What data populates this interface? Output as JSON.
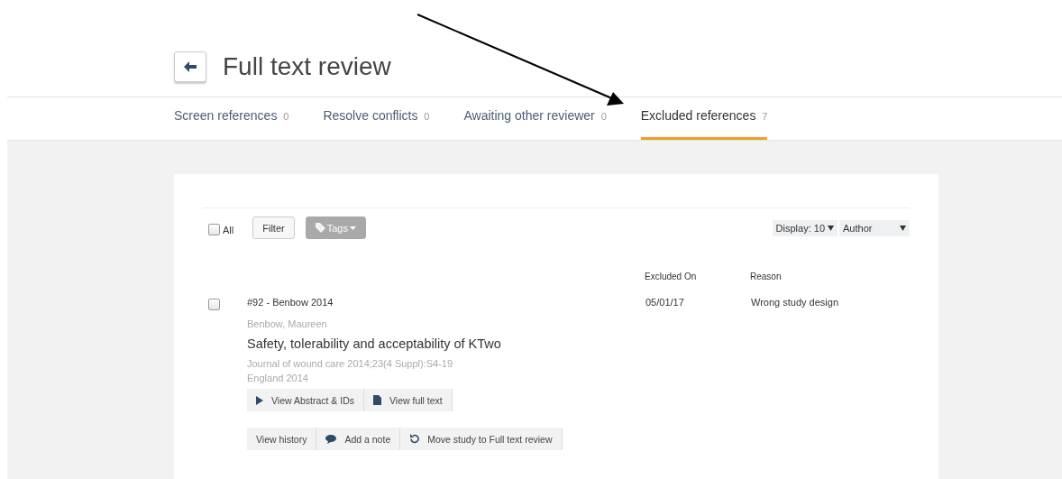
{
  "page": {
    "title": "Full text review"
  },
  "tabs": [
    {
      "label": "Screen references",
      "count": "0",
      "selected": false
    },
    {
      "label": "Resolve conflicts",
      "count": "0",
      "selected": false
    },
    {
      "label": "Awaiting other reviewer",
      "count": "0",
      "selected": false
    },
    {
      "label": "Excluded references",
      "count": "7",
      "selected": true
    }
  ],
  "toolbar": {
    "select_all": {
      "label": "All",
      "checked": false
    },
    "filter": "Filter",
    "tags": {
      "label": "Tags",
      "disabled": true
    },
    "display": "Display: 10",
    "sort": "Author"
  },
  "columns": [
    "Excluded On",
    "Reason"
  ],
  "references": [
    {
      "checked": false,
      "id": "#92 - Benbow 2014",
      "authors": "Benbow, Maureen",
      "title": "Safety, tolerability and acceptability of KTwo",
      "journal": "Journal of wound care 2014;23(4 Suppl):S4-19",
      "country": "England 2014",
      "excluded_on": "05/01/17",
      "reason": "Wrong study design",
      "actions": [
        {
          "kind": "play",
          "label": "View Abstract & IDs"
        },
        {
          "kind": "doc",
          "label": "View full text"
        }
      ],
      "more_actions": [
        {
          "kind": "plain",
          "label": "View history"
        },
        {
          "kind": "comment",
          "label": "Add a note"
        },
        {
          "kind": "undo",
          "label": "Move study to Full text review"
        }
      ]
    }
  ]
}
